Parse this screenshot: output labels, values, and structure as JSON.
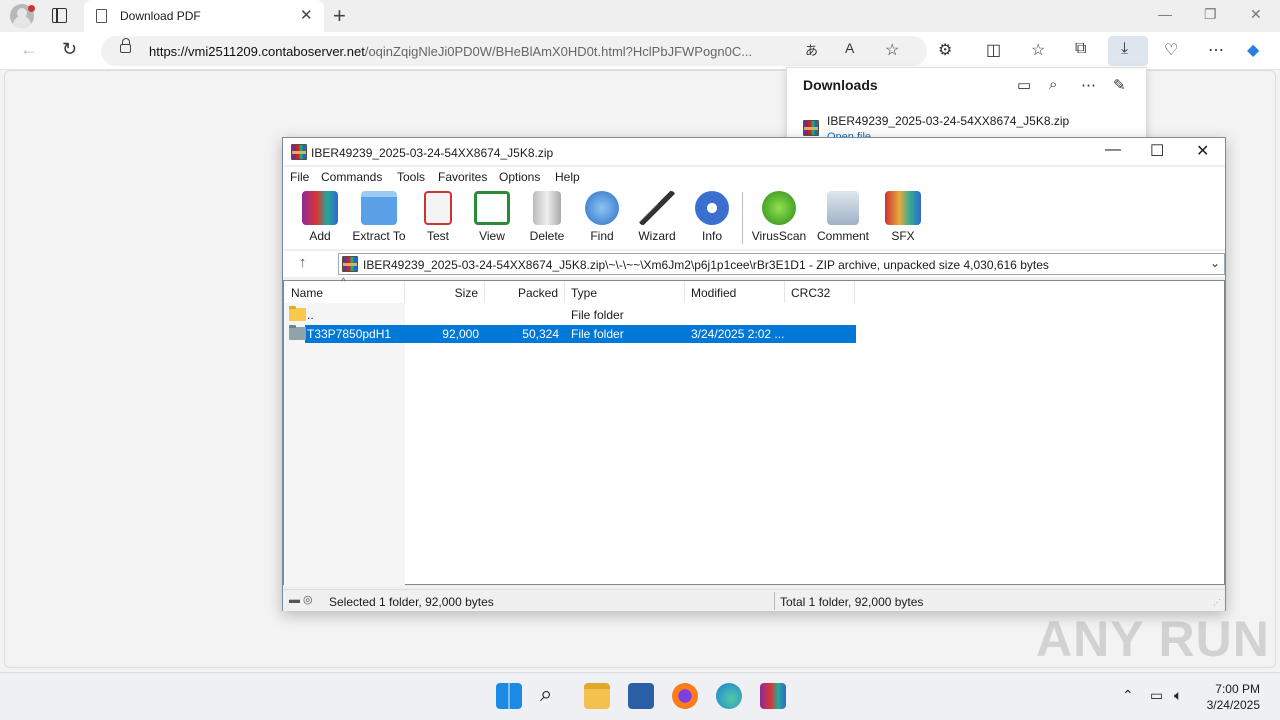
{
  "browser": {
    "tab_title": "Download PDF",
    "url_host": "https://vmi2511209.contaboserver.net",
    "url_path": "/oqinZqigNleJi0PD0W/BHeBlAmX0HD0t.html?HclPbJFWPogn0C..."
  },
  "downloads": {
    "title": "Downloads",
    "file_name": "IBER49239_2025-03-24-54XX8674_J5K8.zip",
    "open_link": "Open file"
  },
  "winrar": {
    "title": "IBER49239_2025-03-24-54XX8674_J5K8.zip",
    "menu": [
      "File",
      "Commands",
      "Tools",
      "Favorites",
      "Options",
      "Help"
    ],
    "toolbar": [
      "Add",
      "Extract To",
      "Test",
      "View",
      "Delete",
      "Find",
      "Wizard",
      "Info",
      "VirusScan",
      "Comment",
      "SFX"
    ],
    "path": "IBER49239_2025-03-24-54XX8674_J5K8.zip\\~\\-\\~~\\Xm6Jm2\\p6j1p1cee\\rBr3E1D1 - ZIP archive, unpacked size 4,030,616 bytes",
    "columns": [
      "Name",
      "Size",
      "Packed",
      "Type",
      "Modified",
      "CRC32"
    ],
    "rows": [
      {
        "name": "..",
        "size": "",
        "packed": "",
        "type": "File folder",
        "modified": "",
        "crc": ""
      },
      {
        "name": "T33P7850pdH1",
        "size": "92,000",
        "packed": "50,324",
        "type": "File folder",
        "modified": "3/24/2025 2:02 ...",
        "crc": ""
      }
    ],
    "status_left": "Selected 1 folder, 92,000 bytes",
    "status_right": "Total 1 folder, 92,000 bytes"
  },
  "taskbar": {
    "time": "7:00 PM",
    "date": "3/24/2025"
  },
  "watermark": "ANY RUN",
  "colors": {
    "selection": "#0078d7",
    "accent": "#0f6cbd"
  }
}
